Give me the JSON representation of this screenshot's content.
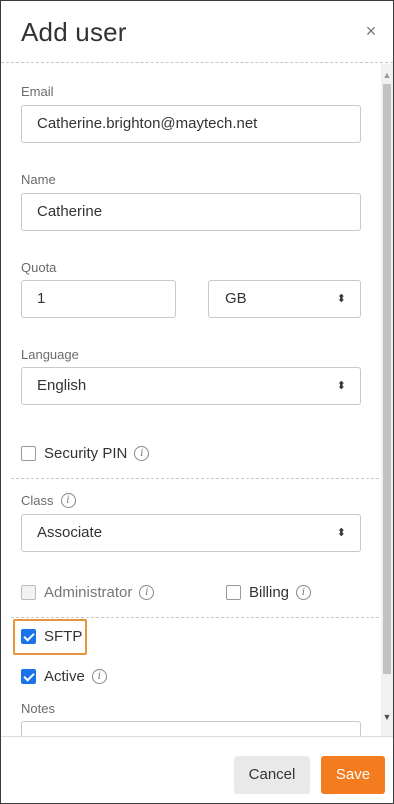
{
  "dialog": {
    "title": "Add user",
    "close_glyph": "×"
  },
  "form": {
    "email": {
      "label": "Email",
      "value": "Catherine.brighton@maytech.net"
    },
    "name": {
      "label": "Name",
      "value": "Catherine"
    },
    "quota": {
      "label": "Quota",
      "value": "1",
      "unit": "GB"
    },
    "language": {
      "label": "Language",
      "value": "English"
    },
    "security_pin": {
      "label": "Security PIN",
      "checked": false
    },
    "class": {
      "label": "Class",
      "value": "Associate"
    },
    "administrator": {
      "label": "Administrator",
      "checked": false,
      "disabled": true
    },
    "billing": {
      "label": "Billing",
      "checked": false
    },
    "sftp": {
      "label": "SFTP",
      "checked": true
    },
    "active": {
      "label": "Active",
      "checked": true
    },
    "notes": {
      "label": "Notes",
      "value": ""
    }
  },
  "icons": {
    "info_glyph": "i",
    "select_arrow_glyph": "⬍",
    "scroll_up_glyph": "▲",
    "scroll_down_glyph": "▼"
  },
  "footer": {
    "cancel_label": "Cancel",
    "save_label": "Save"
  },
  "colors": {
    "primary": "#f47c1f",
    "highlight": "#e8933d",
    "checkbox_checked": "#1a73e8"
  }
}
